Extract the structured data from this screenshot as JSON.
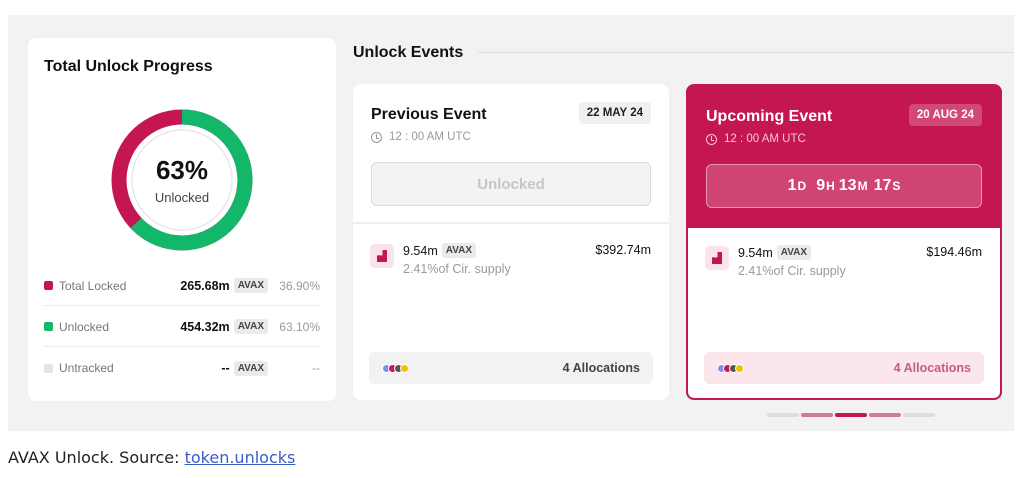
{
  "progress": {
    "title": "Total Unlock Progress",
    "percent_text": "63%",
    "percent_value": 63,
    "center_label": "Unlocked",
    "legend": [
      {
        "label": "Total Locked",
        "amount": "265.68m",
        "unit": "AVAX",
        "pct": "36.90%",
        "color": "#c41653"
      },
      {
        "label": "Unlocked",
        "amount": "454.32m",
        "unit": "AVAX",
        "pct": "63.10%",
        "color": "#12b76a"
      },
      {
        "label": "Untracked",
        "amount": "--",
        "unit": "AVAX",
        "pct": "--",
        "color": "#e4e4e4"
      }
    ]
  },
  "events": {
    "title": "Unlock Events",
    "previous": {
      "name": "Previous Event",
      "date": "22 MAY 24",
      "time": "12 : 00 AM UTC",
      "status_button": "Unlocked",
      "amount": "9.54m",
      "unit": "AVAX",
      "usd": "$392.74m",
      "supply": "2.41%of Cir. supply",
      "allocations": "4 Allocations"
    },
    "upcoming": {
      "name": "Upcoming Event",
      "date": "20 AUG 24",
      "time": "12 : 00 AM UTC",
      "countdown": {
        "days": "1",
        "days_unit": "D",
        "hours": "9",
        "hours_unit": "H",
        "minutes": "13",
        "minutes_unit": "M",
        "seconds": "17",
        "seconds_unit": "S"
      },
      "amount": "9.54m",
      "unit": "AVAX",
      "usd": "$194.46m",
      "supply": "2.41%of Cir. supply",
      "allocations": "4 Allocations"
    },
    "allocation_dot_colors": [
      "#7f8ee8",
      "#c41653",
      "#555555",
      "#f2c200"
    ],
    "pager_colors": [
      "#dddddd",
      "#d67898",
      "#c41653",
      "#d67898",
      "#dddddd"
    ]
  },
  "caption": {
    "text": "AVAX Unlock. Source: ",
    "link": "token.unlocks"
  },
  "colors": {
    "accent": "#c41653",
    "unlocked_green": "#12b76a"
  }
}
